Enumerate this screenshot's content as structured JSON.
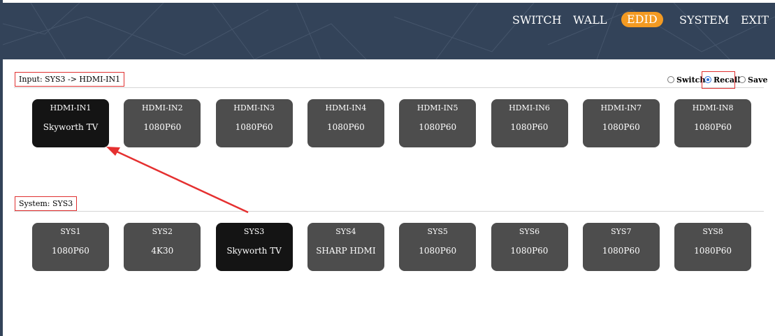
{
  "nav": {
    "items": [
      {
        "label": "SWITCH",
        "active": false
      },
      {
        "label": "WALL",
        "active": false
      },
      {
        "label": "EDID",
        "active": true
      },
      {
        "label": "SYSTEM",
        "active": false
      },
      {
        "label": "EXIT",
        "active": false
      }
    ]
  },
  "input_section": {
    "label": "Input: SYS3 -> HDMI-IN1",
    "mode_options": [
      "Switch",
      "Recall",
      "Save"
    ],
    "selected_mode": "Recall",
    "tiles": [
      {
        "name": "HDMI-IN1",
        "value": "Skyworth TV",
        "selected": true
      },
      {
        "name": "HDMI-IN2",
        "value": "1080P60",
        "selected": false
      },
      {
        "name": "HDMI-IN3",
        "value": "1080P60",
        "selected": false
      },
      {
        "name": "HDMI-IN4",
        "value": "1080P60",
        "selected": false
      },
      {
        "name": "HDMI-IN5",
        "value": "1080P60",
        "selected": false
      },
      {
        "name": "HDMI-IN6",
        "value": "1080P60",
        "selected": false
      },
      {
        "name": "HDMI-IN7",
        "value": "1080P60",
        "selected": false
      },
      {
        "name": "HDMI-IN8",
        "value": "1080P60",
        "selected": false
      }
    ]
  },
  "system_section": {
    "label": "System: SYS3",
    "tiles": [
      {
        "name": "SYS1",
        "value": "1080P60",
        "selected": false
      },
      {
        "name": "SYS2",
        "value": "4K30",
        "selected": false
      },
      {
        "name": "SYS3",
        "value": "Skyworth TV",
        "selected": true
      },
      {
        "name": "SYS4",
        "value": "SHARP HDMI",
        "selected": false
      },
      {
        "name": "SYS5",
        "value": "1080P60",
        "selected": false
      },
      {
        "name": "SYS6",
        "value": "1080P60",
        "selected": false
      },
      {
        "name": "SYS7",
        "value": "1080P60",
        "selected": false
      },
      {
        "name": "SYS8",
        "value": "1080P60",
        "selected": false
      }
    ]
  },
  "colors": {
    "header_bg": "#334359",
    "active_nav": "#f39a22",
    "tile_default": "#4d4d4d",
    "tile_selected": "#141414",
    "annotation_red": "#e03030"
  }
}
